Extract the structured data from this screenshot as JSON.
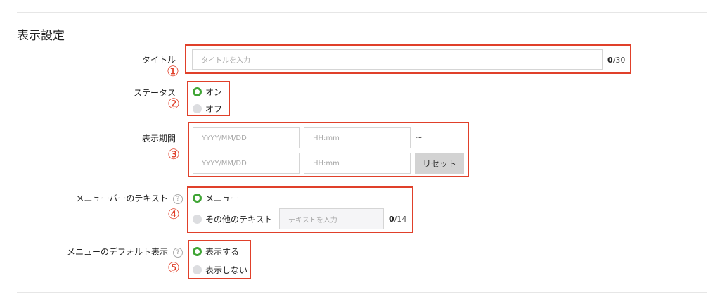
{
  "section": {
    "title": "表示設定"
  },
  "title_field": {
    "label": "タイトル",
    "placeholder": "タイトルを入力",
    "count_current": "0",
    "count_max": "/30",
    "marker": "①"
  },
  "status_field": {
    "label": "ステータス",
    "options": [
      "オン",
      "オフ"
    ],
    "selected": "オン",
    "marker": "②"
  },
  "period_field": {
    "label": "表示期間",
    "start_date_placeholder": "YYYY/MM/DD",
    "start_time_placeholder": "HH:mm",
    "separator": "~",
    "end_date_placeholder": "YYYY/MM/DD",
    "end_time_placeholder": "HH:mm",
    "reset_label": "リセット",
    "marker": "③"
  },
  "menubar_text_field": {
    "label": "メニューバーのテキスト",
    "help": "?",
    "options": [
      "メニュー",
      "その他のテキスト"
    ],
    "selected": "メニュー",
    "text_placeholder": "テキストを入力",
    "count_current": "0",
    "count_max": "/14",
    "marker": "④"
  },
  "menu_default_field": {
    "label": "メニューのデフォルト表示",
    "help": "?",
    "options": [
      "表示する",
      "表示しない"
    ],
    "selected": "表示する",
    "marker": "⑤"
  },
  "colors": {
    "accent_green": "#3fa535",
    "callout_red": "#e0402a"
  }
}
